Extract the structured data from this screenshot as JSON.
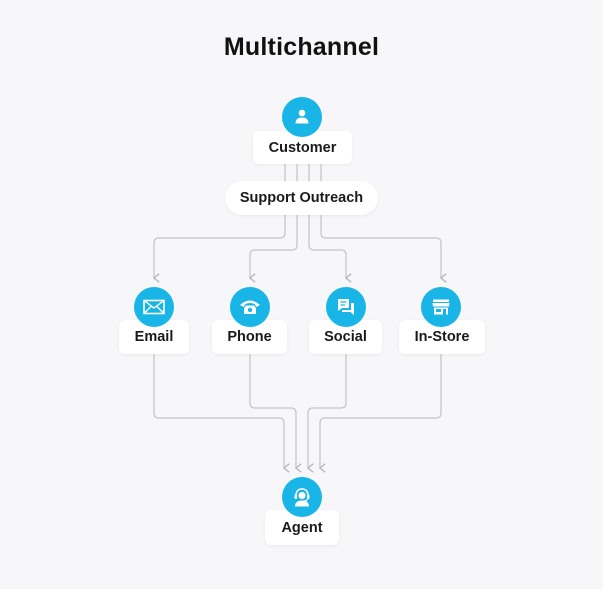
{
  "title": "Multichannel",
  "accent_color": "#19b5e6",
  "nodes": {
    "customer": {
      "label": "Customer",
      "icon": "person-icon"
    },
    "outreach": {
      "label": "Support Outreach"
    },
    "email": {
      "label": "Email",
      "icon": "envelope-icon"
    },
    "phone": {
      "label": "Phone",
      "icon": "telephone-icon"
    },
    "social": {
      "label": "Social",
      "icon": "chat-bubbles-icon"
    },
    "instore": {
      "label": "In-Store",
      "icon": "storefront-icon"
    },
    "agent": {
      "label": "Agent",
      "icon": "headset-agent-icon"
    }
  },
  "edges": [
    {
      "from": "Support Outreach",
      "to": "Email"
    },
    {
      "from": "Support Outreach",
      "to": "Phone"
    },
    {
      "from": "Support Outreach",
      "to": "Social"
    },
    {
      "from": "Support Outreach",
      "to": "In-Store"
    },
    {
      "from": "Email",
      "to": "Agent"
    },
    {
      "from": "Phone",
      "to": "Agent"
    },
    {
      "from": "Social",
      "to": "Agent"
    },
    {
      "from": "In-Store",
      "to": "Agent"
    }
  ]
}
